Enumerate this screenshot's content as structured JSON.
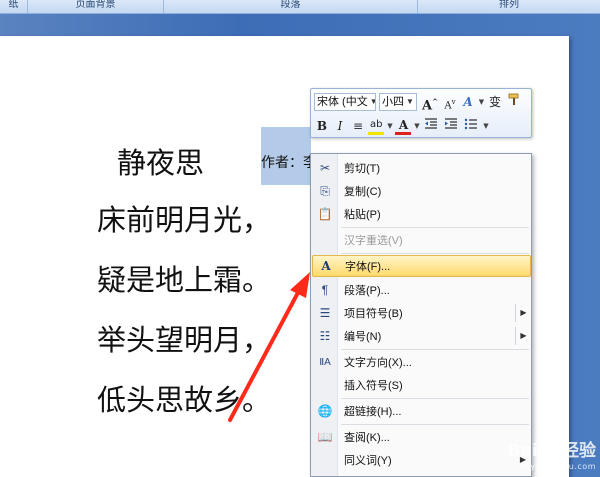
{
  "ribbon": {
    "groups": [
      {
        "label": "纸"
      },
      {
        "label": "页面背景"
      },
      {
        "label": "段落"
      },
      {
        "label": "排列"
      }
    ]
  },
  "document": {
    "title": "静夜思",
    "author": "作者：李",
    "lines": [
      "床前明月光，",
      "疑是地上霜。",
      "举头望明月，",
      "低头思故乡。"
    ]
  },
  "mini_toolbar": {
    "font_name": "宋体 (中文",
    "font_size": "小四",
    "grow_font": "A",
    "shrink_font": "A",
    "styles": "A",
    "phonetic": "变",
    "format_painter": "format-painter-icon",
    "bold": "B",
    "italic": "I",
    "center": "≡",
    "highlight": "ab",
    "font_color": "A",
    "font_color_hex": "#e02020",
    "highlight_hex": "#f2e600"
  },
  "context_menu": {
    "items": [
      {
        "label": "剪切(T)",
        "icon": "✂"
      },
      {
        "label": "复制(C)",
        "icon": "⎘"
      },
      {
        "label": "粘贴(P)",
        "icon": "📋"
      },
      {
        "label": "汉字重选(V)",
        "icon": ""
      },
      {
        "label": "字体(F)...",
        "icon": "A"
      },
      {
        "label": "段落(P)...",
        "icon": "¶"
      },
      {
        "label": "项目符号(B)",
        "icon": "☰"
      },
      {
        "label": "编号(N)",
        "icon": "☷"
      },
      {
        "label": "文字方向(X)...",
        "icon": "ⅡA"
      },
      {
        "label": "插入符号(S)",
        "icon": ""
      },
      {
        "label": "超链接(H)...",
        "icon": "🌐"
      },
      {
        "label": "查阅(K)...",
        "icon": "📖"
      },
      {
        "label": "同义词(Y)",
        "icon": ""
      }
    ]
  },
  "watermark": {
    "brand": "Baidu经验",
    "url": "jingyan.baidu.com"
  },
  "colors": {
    "arrow": "#ff2a1a",
    "hover_item": "#ffd96b",
    "selection": "#b3cbe9"
  }
}
